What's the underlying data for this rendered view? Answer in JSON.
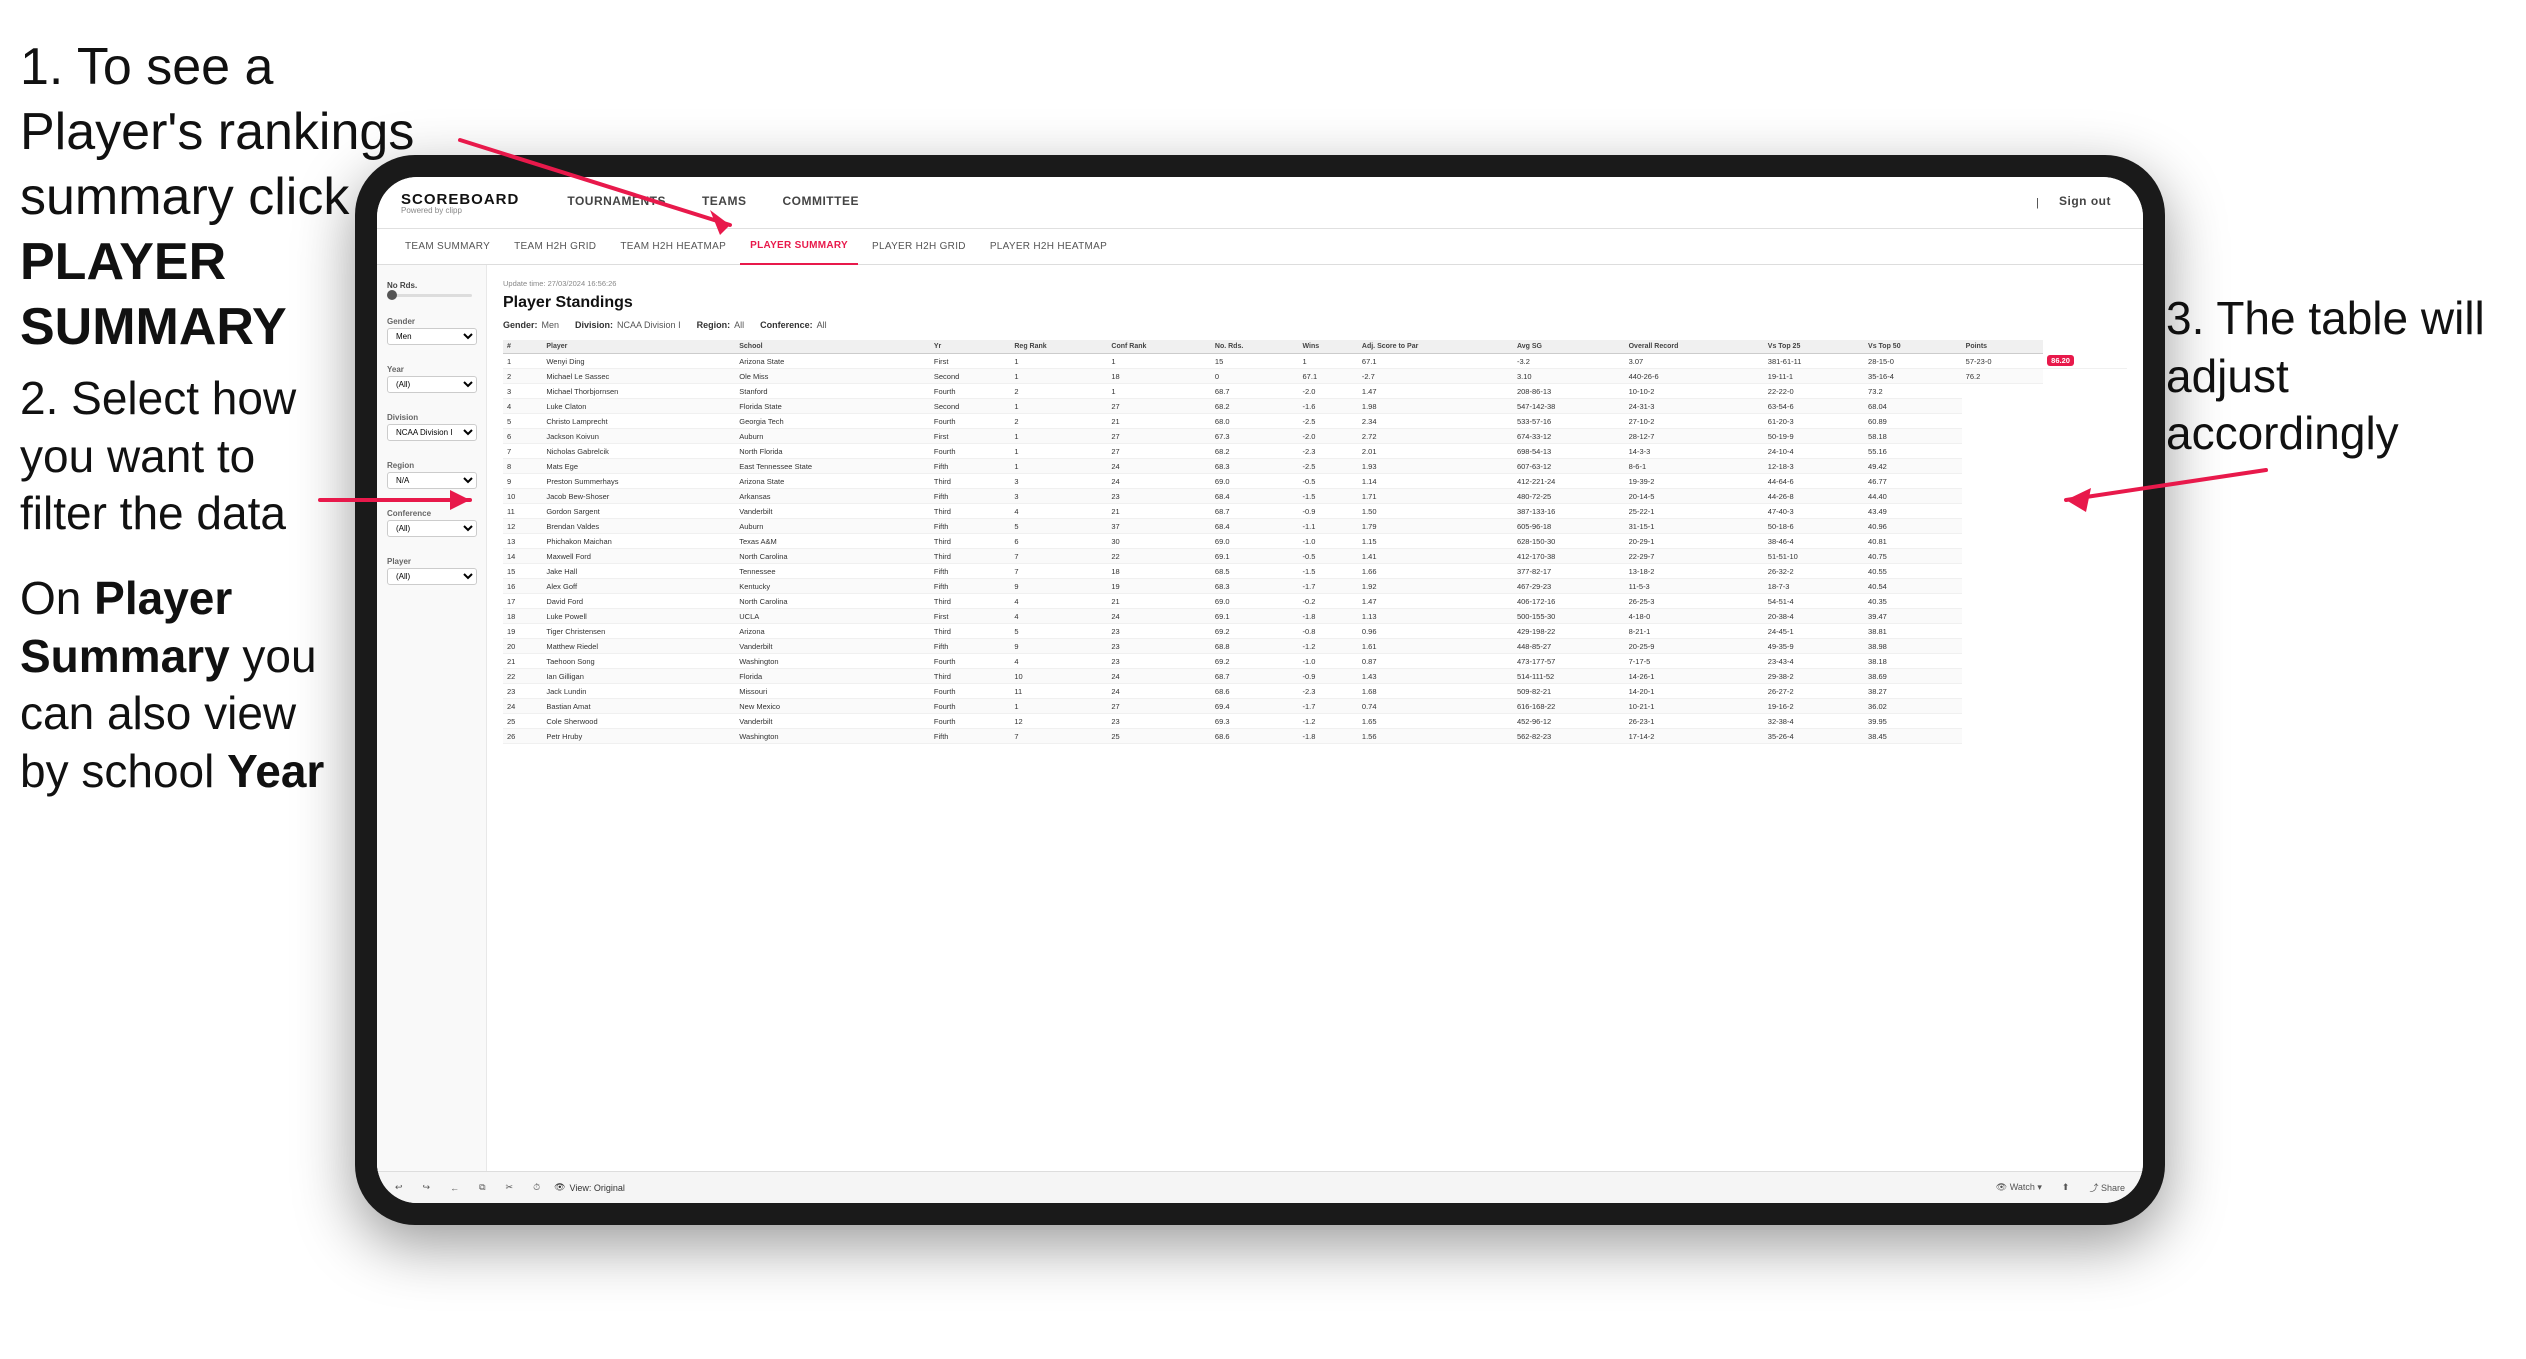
{
  "instructions": {
    "step1": "1. To see a Player's rankings summary click ",
    "step1_bold": "PLAYER SUMMARY",
    "step2_line1": "2. Select how",
    "step2_line2": "you want to",
    "step2_line3": "filter the data",
    "step3_line1": "3. The table will",
    "step3_line2": "adjust accordingly",
    "step4_line1": "On ",
    "step4_bold1": "Player",
    "step4_line2": "Summary",
    "step4_line3": " you",
    "step4_line4": "can also view",
    "step4_line5": "by school ",
    "step4_bold2": "Year"
  },
  "app": {
    "logo": "SCOREBOARD",
    "logo_sub": "Powered by clipp",
    "nav": [
      "TOURNAMENTS",
      "TEAMS",
      "COMMITTEE"
    ],
    "header_right": [
      "Sign out"
    ],
    "sub_nav": [
      "TEAM SUMMARY",
      "TEAM H2H GRID",
      "TEAM H2H HEATMAP",
      "PLAYER SUMMARY",
      "PLAYER H2H GRID",
      "PLAYER H2H HEATMAP"
    ]
  },
  "sidebar": {
    "no_rds_label": "No Rds.",
    "gender_label": "Gender",
    "gender_value": "Men",
    "year_label": "Year",
    "year_value": "(All)",
    "division_label": "Division",
    "division_value": "NCAA Division I",
    "region_label": "Region",
    "region_value": "N/A",
    "conference_label": "Conference",
    "conference_value": "(All)",
    "player_label": "Player",
    "player_value": "(All)"
  },
  "table": {
    "update_time": "Update time: 27/03/2024 16:56:26",
    "title": "Player Standings",
    "gender": "Men",
    "division": "NCAA Division I",
    "region": "All",
    "conference": "All",
    "columns": [
      "#",
      "Player",
      "School",
      "Yr",
      "Reg Rank",
      "Conf Rank",
      "No. Rds.",
      "Wins",
      "Adj. Score to Par",
      "Avg SG",
      "Overall Record",
      "Vs Top 25",
      "Vs Top 50",
      "Points"
    ],
    "rows": [
      [
        "1",
        "Wenyi Ding",
        "Arizona State",
        "First",
        "1",
        "1",
        "15",
        "1",
        "67.1",
        "-3.2",
        "3.07",
        "381-61-11",
        "28-15-0",
        "57-23-0",
        "86.20"
      ],
      [
        "2",
        "Michael Le Sassec",
        "Ole Miss",
        "Second",
        "1",
        "18",
        "0",
        "67.1",
        "-2.7",
        "3.10",
        "440-26-6",
        "19-11-1",
        "35-16-4",
        "76.2"
      ],
      [
        "3",
        "Michael Thorbjornsen",
        "Stanford",
        "Fourth",
        "2",
        "1",
        "68.7",
        "-2.0",
        "1.47",
        "208-86-13",
        "10-10-2",
        "22-22-0",
        "73.2"
      ],
      [
        "4",
        "Luke Claton",
        "Florida State",
        "Second",
        "1",
        "27",
        "68.2",
        "-1.6",
        "1.98",
        "547-142-38",
        "24-31-3",
        "63-54-6",
        "68.04"
      ],
      [
        "5",
        "Christo Lamprecht",
        "Georgia Tech",
        "Fourth",
        "2",
        "21",
        "68.0",
        "-2.5",
        "2.34",
        "533-57-16",
        "27-10-2",
        "61-20-3",
        "60.89"
      ],
      [
        "6",
        "Jackson Koivun",
        "Auburn",
        "First",
        "1",
        "27",
        "67.3",
        "-2.0",
        "2.72",
        "674-33-12",
        "28-12-7",
        "50-19-9",
        "58.18"
      ],
      [
        "7",
        "Nicholas Gabrelcik",
        "North Florida",
        "Fourth",
        "1",
        "27",
        "68.2",
        "-2.3",
        "2.01",
        "698-54-13",
        "14-3-3",
        "24-10-4",
        "55.16"
      ],
      [
        "8",
        "Mats Ege",
        "East Tennessee State",
        "Fifth",
        "1",
        "24",
        "68.3",
        "-2.5",
        "1.93",
        "607-63-12",
        "8-6-1",
        "12-18-3",
        "49.42"
      ],
      [
        "9",
        "Preston Summerhays",
        "Arizona State",
        "Third",
        "3",
        "24",
        "69.0",
        "-0.5",
        "1.14",
        "412-221-24",
        "19-39-2",
        "44-64-6",
        "46.77"
      ],
      [
        "10",
        "Jacob Bew-Shoser",
        "Arkansas",
        "Fifth",
        "3",
        "23",
        "68.4",
        "-1.5",
        "1.71",
        "480-72-25",
        "20-14-5",
        "44-26-8",
        "44.40"
      ],
      [
        "11",
        "Gordon Sargent",
        "Vanderbilt",
        "Third",
        "4",
        "21",
        "68.7",
        "-0.9",
        "1.50",
        "387-133-16",
        "25-22-1",
        "47-40-3",
        "43.49"
      ],
      [
        "12",
        "Brendan Valdes",
        "Auburn",
        "Fifth",
        "5",
        "37",
        "68.4",
        "-1.1",
        "1.79",
        "605-96-18",
        "31-15-1",
        "50-18-6",
        "40.96"
      ],
      [
        "13",
        "Phichakon Maichan",
        "Texas A&M",
        "Third",
        "6",
        "30",
        "69.0",
        "-1.0",
        "1.15",
        "628-150-30",
        "20-29-1",
        "38-46-4",
        "40.81"
      ],
      [
        "14",
        "Maxwell Ford",
        "North Carolina",
        "Third",
        "7",
        "22",
        "69.1",
        "-0.5",
        "1.41",
        "412-170-38",
        "22-29-7",
        "51-51-10",
        "40.75"
      ],
      [
        "15",
        "Jake Hall",
        "Tennessee",
        "Fifth",
        "7",
        "18",
        "68.5",
        "-1.5",
        "1.66",
        "377-82-17",
        "13-18-2",
        "26-32-2",
        "40.55"
      ],
      [
        "16",
        "Alex Goff",
        "Kentucky",
        "Fifth",
        "9",
        "19",
        "68.3",
        "-1.7",
        "1.92",
        "467-29-23",
        "11-5-3",
        "18-7-3",
        "40.54"
      ],
      [
        "17",
        "David Ford",
        "North Carolina",
        "Third",
        "4",
        "21",
        "69.0",
        "-0.2",
        "1.47",
        "406-172-16",
        "26-25-3",
        "54-51-4",
        "40.35"
      ],
      [
        "18",
        "Luke Powell",
        "UCLA",
        "First",
        "4",
        "24",
        "69.1",
        "-1.8",
        "1.13",
        "500-155-30",
        "4-18-0",
        "20-38-4",
        "39.47"
      ],
      [
        "19",
        "Tiger Christensen",
        "Arizona",
        "Third",
        "5",
        "23",
        "69.2",
        "-0.8",
        "0.96",
        "429-198-22",
        "8-21-1",
        "24-45-1",
        "38.81"
      ],
      [
        "20",
        "Matthew Riedel",
        "Vanderbilt",
        "Fifth",
        "9",
        "23",
        "68.8",
        "-1.2",
        "1.61",
        "448-85-27",
        "20-25-9",
        "49-35-9",
        "38.98"
      ],
      [
        "21",
        "Taehoon Song",
        "Washington",
        "Fourth",
        "4",
        "23",
        "69.2",
        "-1.0",
        "0.87",
        "473-177-57",
        "7-17-5",
        "23-43-4",
        "38.18"
      ],
      [
        "22",
        "Ian Gilligan",
        "Florida",
        "Third",
        "10",
        "24",
        "68.7",
        "-0.9",
        "1.43",
        "514-111-52",
        "14-26-1",
        "29-38-2",
        "38.69"
      ],
      [
        "23",
        "Jack Lundin",
        "Missouri",
        "Fourth",
        "11",
        "24",
        "68.6",
        "-2.3",
        "1.68",
        "509-82-21",
        "14-20-1",
        "26-27-2",
        "38.27"
      ],
      [
        "24",
        "Bastian Amat",
        "New Mexico",
        "Fourth",
        "1",
        "27",
        "69.4",
        "-1.7",
        "0.74",
        "616-168-22",
        "10-21-1",
        "19-16-2",
        "36.02"
      ],
      [
        "25",
        "Cole Sherwood",
        "Vanderbilt",
        "Fourth",
        "12",
        "23",
        "69.3",
        "-1.2",
        "1.65",
        "452-96-12",
        "26-23-1",
        "32-38-4",
        "39.95"
      ],
      [
        "26",
        "Petr Hruby",
        "Washington",
        "Fifth",
        "7",
        "25",
        "68.6",
        "-1.8",
        "1.56",
        "562-82-23",
        "17-14-2",
        "35-26-4",
        "38.45"
      ]
    ]
  },
  "toolbar": {
    "view_label": "View: Original",
    "watch_label": "Watch",
    "share_label": "Share"
  }
}
